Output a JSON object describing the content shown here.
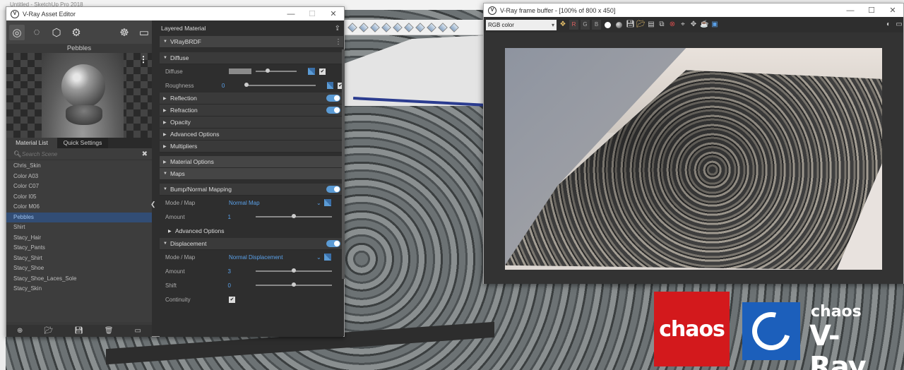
{
  "sketchup": {
    "title": "Untitled - SketchUp Pro 2018"
  },
  "asset_editor": {
    "title": "V-Ray Asset Editor",
    "preview_title": "Pebbles",
    "tabs": [
      "Material List",
      "Quick Settings"
    ],
    "search_placeholder": "Search Scene",
    "materials": [
      "Chris_Skin",
      "Color A03",
      "Color C07",
      "Color I05",
      "Color M06",
      "Pebbles",
      "Shirt",
      "Stacy_Hair",
      "Stacy_Pants",
      "Stacy_Shirt",
      "Stacy_Shoe",
      "Stacy_Shoe_Laces_Sole",
      "Stacy_Skin"
    ],
    "selected_material": "Pebbles",
    "header": "Layered Material",
    "brdf": "VRayBRDF",
    "sections": {
      "diffuse": "Diffuse",
      "reflection": "Reflection",
      "refraction": "Refraction",
      "opacity": "Opacity",
      "advanced_options": "Advanced Options",
      "multipliers": "Multipliers",
      "material_options": "Material Options",
      "maps": "Maps",
      "bump": "Bump/Normal Mapping",
      "bump_advanced": "Advanced Options",
      "displacement": "Displacement"
    },
    "params": {
      "diffuse_label": "Diffuse",
      "roughness_label": "Roughness",
      "roughness_value": "0",
      "mode_map_label": "Mode / Map",
      "bump_mode_value": "Normal Map",
      "amount_label": "Amount",
      "bump_amount_value": "1",
      "disp_mode_value": "Normal Displacement",
      "disp_amount_value": "3",
      "shift_label": "Shift",
      "shift_value": "0",
      "continuity_label": "Continuity"
    },
    "sliders": {
      "diffuse": 0.3,
      "roughness": 0.0,
      "bump_amount": 0.5,
      "disp_amount": 0.5,
      "shift": 0.5
    }
  },
  "frame_buffer": {
    "title": "V-Ray frame buffer - [100% of 800 x 450]",
    "channel": "RGB color",
    "channel_buttons": [
      "R",
      "G",
      "B"
    ]
  },
  "logos": {
    "chaos": "chaos",
    "vray_company": "chaos",
    "vray_product": "V-Ray"
  },
  "colors": {
    "accent_blue": "#5b9bd5",
    "chaos_red": "#d3191c",
    "vray_blue": "#1c5fbb",
    "selection": "#324d75"
  }
}
